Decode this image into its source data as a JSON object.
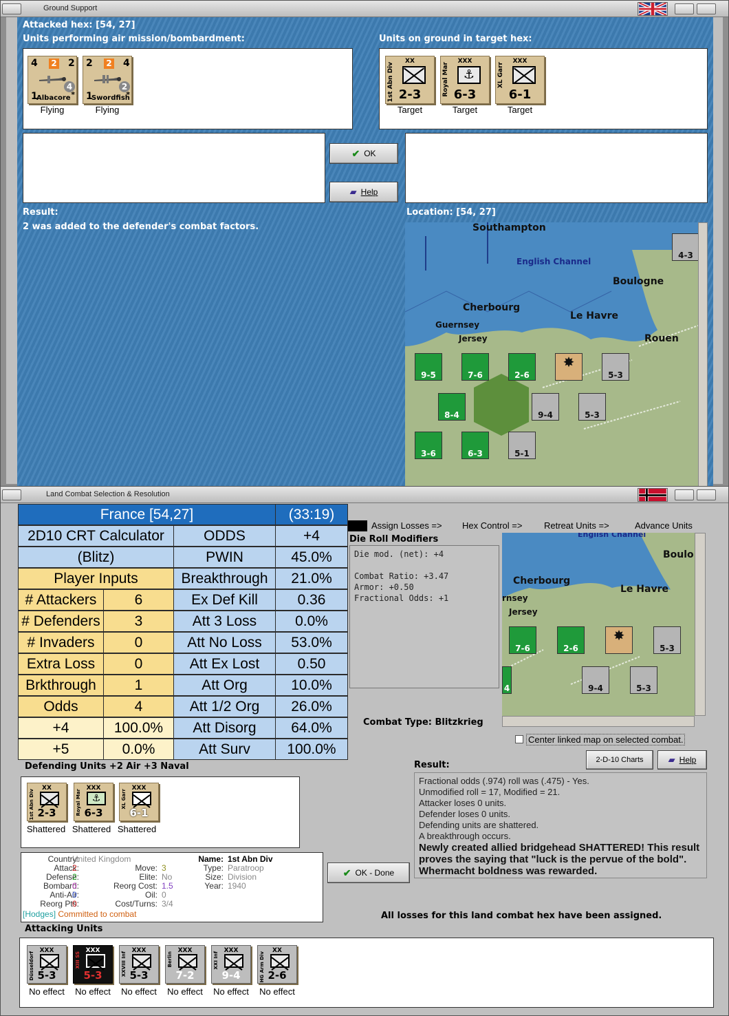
{
  "ground_support": {
    "window_title": "Ground Support",
    "attacked_hex_label": "Attacked hex:  [54, 27]",
    "air_units_label": "Units performing air mission/bombardment:",
    "ground_units_label": "Units on ground in target hex:",
    "air_units": [
      {
        "name": "Albacore",
        "left": "4",
        "badge": "2",
        "right": "2",
        "circle": "4",
        "bottom": "1",
        "star": "*",
        "status": "Flying"
      },
      {
        "name": "Swordfish",
        "left": "2",
        "badge": "2",
        "right": "4",
        "circle": "2",
        "bottom": "1",
        "star": "*",
        "status": "Flying"
      }
    ],
    "ground_units": [
      {
        "side": "1st Abn Div",
        "size": "XX",
        "value": "2-3",
        "status": "Target"
      },
      {
        "side": "Royal Mar",
        "size": "XXX",
        "value": "6-3",
        "status": "Target"
      },
      {
        "side": "XL Garr",
        "size": "XXX",
        "value": "6-1",
        "status": "Target"
      }
    ],
    "ok_label": "OK",
    "help_label": "Help",
    "result_label": "Result:",
    "result_text": "2 was added to the defender's combat factors.",
    "location_label": "Location:  [54, 27]",
    "map": {
      "places": [
        "Southampton",
        "English Channel",
        "Boulogne",
        "Cherbourg",
        "Le Havre",
        "Guernsey",
        "Jersey",
        "Rouen"
      ],
      "units": [
        "9-5",
        "7-6",
        "2-6",
        "5-3",
        "8-4",
        "9-4",
        "5-3",
        "3-6",
        "6-3",
        "5-1",
        "4-3"
      ]
    }
  },
  "land_combat": {
    "window_title": "Land Combat Selection & Resolution",
    "crt": {
      "header_left": "France [54,27]",
      "header_right": "(33:19)",
      "calc_title_1": "2D10 CRT Calculator",
      "calc_title_2": "(Blitz)",
      "player_inputs": "Player Inputs",
      "inputs": [
        {
          "label": "# Attackers",
          "value": "6"
        },
        {
          "label": "# Defenders",
          "value": "3"
        },
        {
          "label": "# Invaders",
          "value": "0"
        },
        {
          "label": "Extra Loss",
          "value": "0"
        },
        {
          "label": "Brkthrough",
          "value": "1"
        },
        {
          "label": "Odds",
          "value": "4"
        },
        {
          "label": "+4",
          "value": "100.0%"
        },
        {
          "label": "+5",
          "value": "0.0%"
        }
      ],
      "results": [
        {
          "label": "ODDS",
          "value": "+4"
        },
        {
          "label": "PWIN",
          "value": "45.0%"
        },
        {
          "label": "Breakthrough",
          "value": "21.0%"
        },
        {
          "label": "Ex Def Kill",
          "value": "0.36"
        },
        {
          "label": "Att 3 Loss",
          "value": "0.0%"
        },
        {
          "label": "Att No Loss",
          "value": "53.0%"
        },
        {
          "label": "Att Ex Lost",
          "value": "0.50"
        },
        {
          "label": "Att Org",
          "value": "10.0%"
        },
        {
          "label": "Att 1/2 Org",
          "value": "26.0%"
        },
        {
          "label": "Att Disorg",
          "value": "64.0%"
        },
        {
          "label": "Att Surv",
          "value": "100.0%"
        }
      ]
    },
    "phases": [
      "Assign Losses =>",
      "Hex Control =>",
      "Retreat Units =>",
      "Advance Units"
    ],
    "die_mod_title": "Die Roll Modifiers",
    "die_mod_text": "Die mod. (net): +4\n\nCombat Ratio: +3.47\nArmor: +0.50\nFractional Odds: +1",
    "combat_type": "Combat Type:  Blitzkrieg",
    "center_map_label": "Center linked map on selected combat.",
    "charts_label": "2-D-10 Charts",
    "help_label": "Help",
    "result_label": "Result:",
    "result_lines": [
      "Fractional odds (.974) roll was (.475)  - Yes.",
      "Unmodified roll = 17, Modified = 21.",
      "Attacker loses 0 units.",
      "Defender loses 0 units.",
      "Defending units are shattered.",
      "A breakthrough occurs."
    ],
    "result_emphasis": "Newly created allied bridgehead SHATTERED!  This result proves the saying that \"luck is the pervue of the bold\".  Whermacht boldness was rewarded.",
    "ok_done_label": "OK - Done",
    "losses_assigned": "All losses for this land combat hex have been assigned.",
    "defending_label": "Defending Units +2 Air +3 Naval",
    "defending_units": [
      {
        "side": "1st Abn Div",
        "size": "XX",
        "value": "2-3",
        "status": "Shattered"
      },
      {
        "side": "Royal Mar",
        "size": "XXX",
        "value": "6-3",
        "status": "Shattered"
      },
      {
        "side": "XL Garr",
        "size": "XXX",
        "value": "6-1",
        "status": "Shattered"
      }
    ],
    "unit_info": {
      "country_label": "Country:",
      "country": "United Kingdom",
      "attack_label": "Attack:",
      "attack": "2",
      "defense_label": "Defense:",
      "defense": "2",
      "bombard_label": "Bombard:",
      "bombard": "0",
      "antiair_label": "Anti-Air:",
      "antiair": "0",
      "reorg_pts_label": "Reorg Pts:",
      "reorg_pts": "0",
      "move_label": "Move:",
      "move": "3",
      "elite_label": "Elite:",
      "elite": "No",
      "reorg_cost_label": "Reorg Cost:",
      "reorg_cost": "1.5",
      "oil_label": "Oil:",
      "oil": "0",
      "cost_label": "Cost/Turns:",
      "cost": "3/4",
      "name_label": "Name:",
      "name": "1st Abn Div",
      "type_label": "Type:",
      "type": "Paratroop",
      "size_label": "Size:",
      "size": "Division",
      "year_label": "Year:",
      "year": "1940",
      "commander": "[Hodges]",
      "commander_status": "Committed to combat"
    },
    "attacking_label": "Attacking Units",
    "attacking_units": [
      {
        "side": "Düsseldorf",
        "size": "XXX",
        "value": "5-3",
        "status": "No effect"
      },
      {
        "side": "XIII SS",
        "size": "XXX",
        "value": "5-3",
        "status": "No effect"
      },
      {
        "side": "XXVIII Inf",
        "size": "XXX",
        "value": "5-3",
        "status": "No effect"
      },
      {
        "side": "Berlin",
        "size": "XXX",
        "value": "7-2",
        "status": "No effect"
      },
      {
        "side": "XXI Inf",
        "size": "XXX",
        "value": "9-4",
        "status": "No effect"
      },
      {
        "side": "HG Arm Div",
        "size": "XX",
        "value": "2-6",
        "status": "No effect"
      }
    ],
    "mini_map": {
      "places": [
        "English Channel",
        "Boulo",
        "Cherbourg",
        "Le Havre",
        "rnsey",
        "Jersey"
      ],
      "units": [
        "7-6",
        "2-6",
        "5-3",
        "9-4",
        "5-3",
        "4"
      ]
    }
  }
}
